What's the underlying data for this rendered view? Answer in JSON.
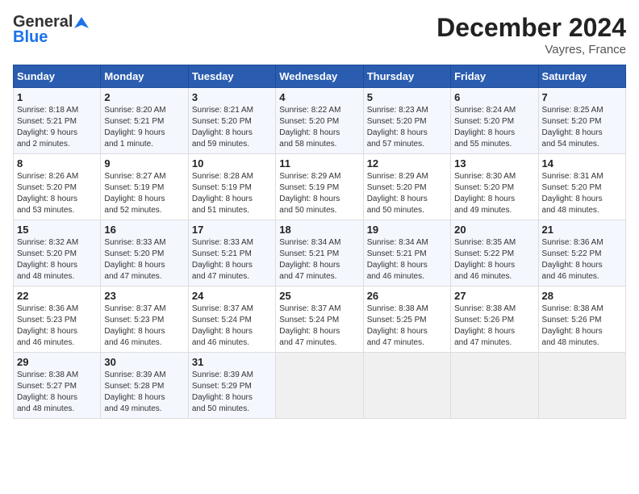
{
  "logo": {
    "line1": "General",
    "line2": "Blue"
  },
  "title": "December 2024",
  "subtitle": "Vayres, France",
  "days_header": [
    "Sunday",
    "Monday",
    "Tuesday",
    "Wednesday",
    "Thursday",
    "Friday",
    "Saturday"
  ],
  "weeks": [
    [
      {
        "day": "1",
        "info": "Sunrise: 8:18 AM\nSunset: 5:21 PM\nDaylight: 9 hours\nand 2 minutes."
      },
      {
        "day": "2",
        "info": "Sunrise: 8:20 AM\nSunset: 5:21 PM\nDaylight: 9 hours\nand 1 minute."
      },
      {
        "day": "3",
        "info": "Sunrise: 8:21 AM\nSunset: 5:20 PM\nDaylight: 8 hours\nand 59 minutes."
      },
      {
        "day": "4",
        "info": "Sunrise: 8:22 AM\nSunset: 5:20 PM\nDaylight: 8 hours\nand 58 minutes."
      },
      {
        "day": "5",
        "info": "Sunrise: 8:23 AM\nSunset: 5:20 PM\nDaylight: 8 hours\nand 57 minutes."
      },
      {
        "day": "6",
        "info": "Sunrise: 8:24 AM\nSunset: 5:20 PM\nDaylight: 8 hours\nand 55 minutes."
      },
      {
        "day": "7",
        "info": "Sunrise: 8:25 AM\nSunset: 5:20 PM\nDaylight: 8 hours\nand 54 minutes."
      }
    ],
    [
      {
        "day": "8",
        "info": "Sunrise: 8:26 AM\nSunset: 5:20 PM\nDaylight: 8 hours\nand 53 minutes."
      },
      {
        "day": "9",
        "info": "Sunrise: 8:27 AM\nSunset: 5:19 PM\nDaylight: 8 hours\nand 52 minutes."
      },
      {
        "day": "10",
        "info": "Sunrise: 8:28 AM\nSunset: 5:19 PM\nDaylight: 8 hours\nand 51 minutes."
      },
      {
        "day": "11",
        "info": "Sunrise: 8:29 AM\nSunset: 5:19 PM\nDaylight: 8 hours\nand 50 minutes."
      },
      {
        "day": "12",
        "info": "Sunrise: 8:29 AM\nSunset: 5:20 PM\nDaylight: 8 hours\nand 50 minutes."
      },
      {
        "day": "13",
        "info": "Sunrise: 8:30 AM\nSunset: 5:20 PM\nDaylight: 8 hours\nand 49 minutes."
      },
      {
        "day": "14",
        "info": "Sunrise: 8:31 AM\nSunset: 5:20 PM\nDaylight: 8 hours\nand 48 minutes."
      }
    ],
    [
      {
        "day": "15",
        "info": "Sunrise: 8:32 AM\nSunset: 5:20 PM\nDaylight: 8 hours\nand 48 minutes."
      },
      {
        "day": "16",
        "info": "Sunrise: 8:33 AM\nSunset: 5:20 PM\nDaylight: 8 hours\nand 47 minutes."
      },
      {
        "day": "17",
        "info": "Sunrise: 8:33 AM\nSunset: 5:21 PM\nDaylight: 8 hours\nand 47 minutes."
      },
      {
        "day": "18",
        "info": "Sunrise: 8:34 AM\nSunset: 5:21 PM\nDaylight: 8 hours\nand 47 minutes."
      },
      {
        "day": "19",
        "info": "Sunrise: 8:34 AM\nSunset: 5:21 PM\nDaylight: 8 hours\nand 46 minutes."
      },
      {
        "day": "20",
        "info": "Sunrise: 8:35 AM\nSunset: 5:22 PM\nDaylight: 8 hours\nand 46 minutes."
      },
      {
        "day": "21",
        "info": "Sunrise: 8:36 AM\nSunset: 5:22 PM\nDaylight: 8 hours\nand 46 minutes."
      }
    ],
    [
      {
        "day": "22",
        "info": "Sunrise: 8:36 AM\nSunset: 5:23 PM\nDaylight: 8 hours\nand 46 minutes."
      },
      {
        "day": "23",
        "info": "Sunrise: 8:37 AM\nSunset: 5:23 PM\nDaylight: 8 hours\nand 46 minutes."
      },
      {
        "day": "24",
        "info": "Sunrise: 8:37 AM\nSunset: 5:24 PM\nDaylight: 8 hours\nand 46 minutes."
      },
      {
        "day": "25",
        "info": "Sunrise: 8:37 AM\nSunset: 5:24 PM\nDaylight: 8 hours\nand 47 minutes."
      },
      {
        "day": "26",
        "info": "Sunrise: 8:38 AM\nSunset: 5:25 PM\nDaylight: 8 hours\nand 47 minutes."
      },
      {
        "day": "27",
        "info": "Sunrise: 8:38 AM\nSunset: 5:26 PM\nDaylight: 8 hours\nand 47 minutes."
      },
      {
        "day": "28",
        "info": "Sunrise: 8:38 AM\nSunset: 5:26 PM\nDaylight: 8 hours\nand 48 minutes."
      }
    ],
    [
      {
        "day": "29",
        "info": "Sunrise: 8:38 AM\nSunset: 5:27 PM\nDaylight: 8 hours\nand 48 minutes."
      },
      {
        "day": "30",
        "info": "Sunrise: 8:39 AM\nSunset: 5:28 PM\nDaylight: 8 hours\nand 49 minutes."
      },
      {
        "day": "31",
        "info": "Sunrise: 8:39 AM\nSunset: 5:29 PM\nDaylight: 8 hours\nand 50 minutes."
      },
      {
        "day": "",
        "info": ""
      },
      {
        "day": "",
        "info": ""
      },
      {
        "day": "",
        "info": ""
      },
      {
        "day": "",
        "info": ""
      }
    ]
  ]
}
